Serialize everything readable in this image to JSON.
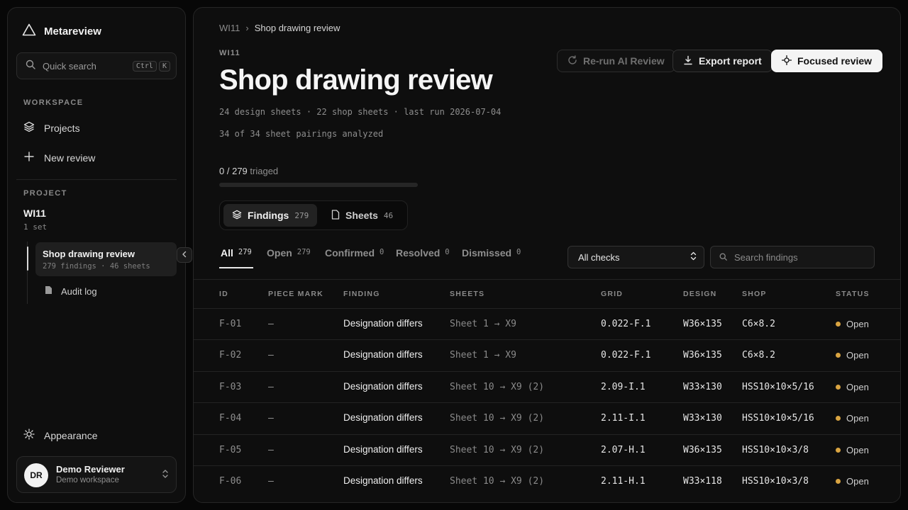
{
  "app": {
    "name": "Metareview"
  },
  "sidebar": {
    "search_label": "Quick search",
    "search_keys": [
      "Ctrl",
      "K"
    ],
    "workspace_label": "WORKSPACE",
    "nav": [
      {
        "label": "Projects",
        "icon": "layers-icon"
      },
      {
        "label": "New review",
        "icon": "plus-icon"
      }
    ],
    "project_label": "PROJECT",
    "project": {
      "name": "WI11",
      "sub": "1 set"
    },
    "tree": {
      "active": {
        "title": "Shop drawing review",
        "sub": "279 findings · 46 sheets"
      },
      "item": {
        "label": "Audit log"
      }
    },
    "appearance_label": "Appearance",
    "user": {
      "initials": "DR",
      "name": "Demo Reviewer",
      "workspace": "Demo workspace"
    }
  },
  "breadcrumb": {
    "parent": "WI11",
    "separator": "›",
    "current": "Shop drawing review"
  },
  "header": {
    "eyebrow": "WI11",
    "title": "Shop drawing review",
    "meta1": "24 design sheets · 22 shop sheets · last run 2026-07-04",
    "meta2": "34 of 34 sheet pairings analyzed"
  },
  "actions": {
    "rerun": "Re-run AI Review",
    "export": "Export report",
    "focus": "Focused review"
  },
  "triage": {
    "done": "0",
    "total": "/ 279",
    "suffix": "triaged",
    "fraction": 0
  },
  "segments": [
    {
      "label": "Findings",
      "count": "279"
    },
    {
      "label": "Sheets",
      "count": "46"
    }
  ],
  "filter_tabs": [
    {
      "label": "All",
      "count": "279"
    },
    {
      "label": "Open",
      "count": "279"
    },
    {
      "label": "Confirmed",
      "count": "0"
    },
    {
      "label": "Resolved",
      "count": "0"
    },
    {
      "label": "Dismissed",
      "count": "0"
    }
  ],
  "check_filter": {
    "selected": "All checks"
  },
  "finding_search": {
    "placeholder": "Search findings"
  },
  "table": {
    "columns": [
      "ID",
      "PIECE MARK",
      "FINDING",
      "SHEETS",
      "GRID",
      "DESIGN",
      "SHOP",
      "STATUS"
    ],
    "rows": [
      {
        "id": "F-01",
        "piece": "—",
        "finding": "Designation differs",
        "sheets": "Sheet 1 → X9",
        "grid": "0.022-F.1",
        "design": "W36×135",
        "shop": "C6×8.2",
        "status": "Open"
      },
      {
        "id": "F-02",
        "piece": "—",
        "finding": "Designation differs",
        "sheets": "Sheet 1 → X9",
        "grid": "0.022-F.1",
        "design": "W36×135",
        "shop": "C6×8.2",
        "status": "Open"
      },
      {
        "id": "F-03",
        "piece": "—",
        "finding": "Designation differs",
        "sheets": "Sheet 10 → X9 (2)",
        "grid": "2.09-I.1",
        "design": "W33×130",
        "shop": "HSS10×10×5/16",
        "status": "Open"
      },
      {
        "id": "F-04",
        "piece": "—",
        "finding": "Designation differs",
        "sheets": "Sheet 10 → X9 (2)",
        "grid": "2.11-I.1",
        "design": "W33×130",
        "shop": "HSS10×10×5/16",
        "status": "Open"
      },
      {
        "id": "F-05",
        "piece": "—",
        "finding": "Designation differs",
        "sheets": "Sheet 10 → X9 (2)",
        "grid": "2.07-H.1",
        "design": "W36×135",
        "shop": "HSS10×10×3/8",
        "status": "Open"
      },
      {
        "id": "F-06",
        "piece": "—",
        "finding": "Designation differs",
        "sheets": "Sheet 10 → X9 (2)",
        "grid": "2.11-H.1",
        "design": "W33×118",
        "shop": "HSS10×10×3/8",
        "status": "Open"
      }
    ]
  },
  "colors": {
    "status_open": "#d9a441",
    "accent": "#f4f4f4"
  }
}
